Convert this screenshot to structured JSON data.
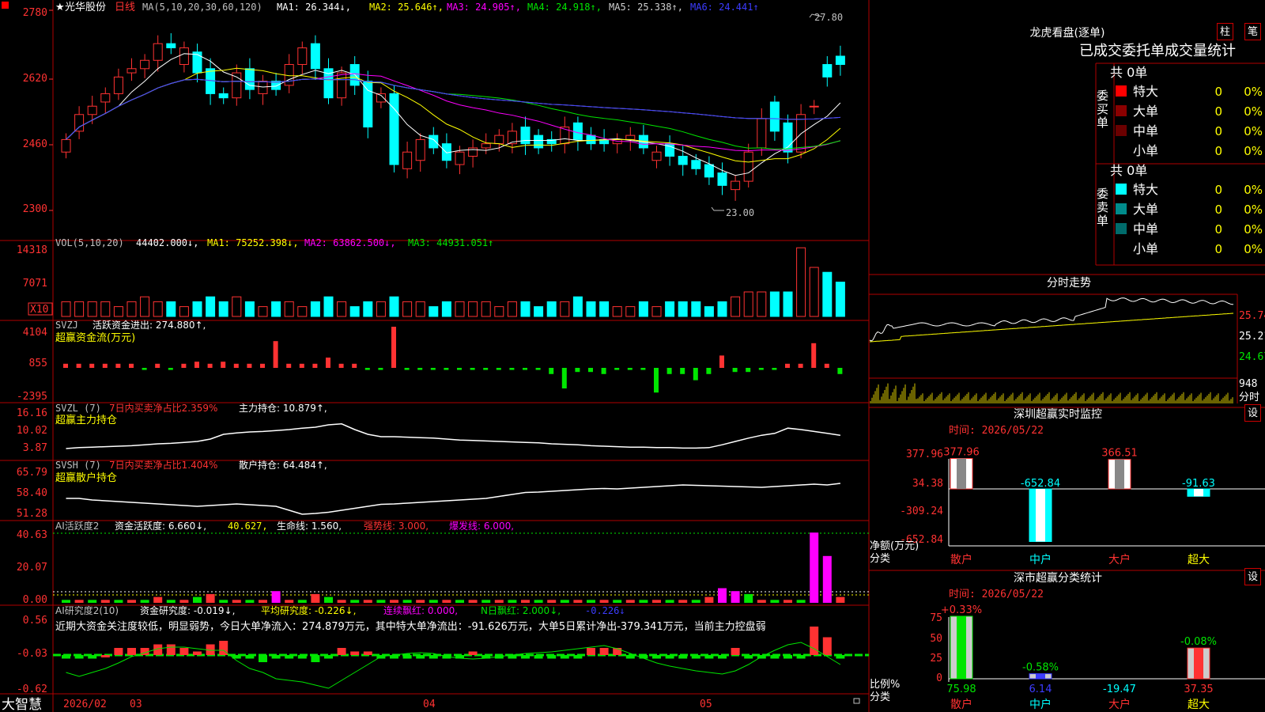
{
  "stock": {
    "name": "光华股份",
    "period": "日线",
    "star": "★"
  },
  "colors": {
    "up": "#ff3232",
    "down": "#00ffff",
    "frame": "#b00000",
    "yellow": "#ffff00",
    "magenta": "#ff00ff",
    "green": "#00e600",
    "white": "#ffffff",
    "gray": "#cfcfcf",
    "blue": "#3c3cff"
  },
  "price_panel": {
    "ma_label": "MA(5,10,20,30,60,120)",
    "ma1": "MA1: 26.344↓,",
    "ma2": "MA2: 25.646↑,",
    "ma3": "MA3: 24.905↑,",
    "ma4": "MA4: 24.918↑,",
    "ma5": "MA5: 25.338↑,",
    "ma6": "MA6: 24.441↑",
    "y_ticks": [
      "2780",
      "2620",
      "2460",
      "2300"
    ],
    "high_label": "27.80",
    "low_label": "23.00"
  },
  "vol_panel": {
    "title": "VOL(5,10,20)",
    "value": "44402.000↓,",
    "ma1": "MA1: 75252.398↓,",
    "ma2": "MA2: 63862.500↓,",
    "ma3": "MA3: 44931.051↑",
    "y_ticks": [
      "14318",
      "7071"
    ],
    "unit": "X10"
  },
  "svzj_panel": {
    "title": "SVZJ",
    "text": "活跃资金进出: 274.880↑,",
    "sub": "超赢资金流(万元)",
    "y_ticks": [
      "4104",
      "855",
      "-2395"
    ]
  },
  "svzl_panel": {
    "title": "SVZL (7)",
    "red_text": "7日内买卖净占比2.359%",
    "text": "主力持仓: 10.879↑,",
    "sub": "超赢主力持仓",
    "y_ticks": [
      "16.16",
      "10.02",
      "3.87"
    ]
  },
  "svsh_panel": {
    "title": "SVSH (7)",
    "red_text": "7日内买卖净占比1.404%",
    "text": "散户持仓: 64.484↑,",
    "sub": "超赢散户持仓",
    "y_ticks": [
      "65.79",
      "58.40",
      "51.28"
    ]
  },
  "ai_active_panel": {
    "title": "AI活跃度2",
    "text1": "资金活跃度: 6.660↓,",
    "text2": "40.627,",
    "text3": "生命线: 1.560,",
    "text4": "强势线: 3.000,",
    "text5": "爆发线: 6.000,",
    "y_ticks": [
      "40.63",
      "20.07",
      "0.00"
    ]
  },
  "ai_research_panel": {
    "title": "AI研究度2(10)",
    "text1": "资金研究度: -0.019↓,",
    "text2": "平均研究度: -0.226↓,",
    "text3": "连续飘红: 0.000,",
    "text4": "N日飘红: 2.000↓,",
    "text5": "-0.226↓",
    "comment": "近期大资金关注度较低，明显弱势，今日大单净流入：274.879万元，其中特大单净流出：-91.626万元，大单5日累计净出-379.341万元，当前主力控盘弱",
    "y_ticks": [
      "0.56",
      "-0.03",
      "-0.62"
    ]
  },
  "footer": {
    "logo": "大智慧",
    "dates": [
      "2026/02",
      "03",
      "04",
      "05"
    ]
  },
  "longhu": {
    "title": "龙虎看盘(逐单)",
    "btn1": "柱",
    "btn2": "笔",
    "header": "已成交委托单成交量统计",
    "buy_label": "委买单",
    "sell_label": "委卖单",
    "buy_total": "共 0单",
    "sell_total": "共 0单",
    "buy_rows": [
      {
        "label": "特大",
        "value": "0",
        "pct": "0%"
      },
      {
        "label": "大单",
        "value": "0",
        "pct": "0%"
      },
      {
        "label": "中单",
        "value": "0",
        "pct": "0%"
      },
      {
        "label": "小单",
        "value": "0",
        "pct": "0%"
      }
    ],
    "sell_rows": [
      {
        "label": "特大",
        "value": "0",
        "pct": "0%"
      },
      {
        "label": "大单",
        "value": "0",
        "pct": "0%"
      },
      {
        "label": "中单",
        "value": "0",
        "pct": "0%"
      },
      {
        "label": "小单",
        "value": "0",
        "pct": "0%"
      }
    ]
  },
  "intraday": {
    "title": "分时走势",
    "y_ticks": [
      "25.74",
      "25.21",
      "24.67"
    ],
    "vol_tick": "948",
    "unit": "分时"
  },
  "sz_monitor": {
    "title": "深圳超赢实时监控",
    "btn": "设",
    "time": "时间: 2026/05/22",
    "y_ticks": [
      "377.96",
      "34.38",
      "-309.24",
      "-652.84"
    ],
    "y_label": "净额(万元)",
    "x_label": "分类",
    "categories": [
      "散户",
      "中户",
      "大户",
      "超大"
    ],
    "values": [
      377.96,
      -652.84,
      366.51,
      -91.63
    ],
    "value_labels": [
      "377.96",
      "-652.84",
      "366.51",
      "-91.63"
    ]
  },
  "sz_classify": {
    "title": "深市超赢分类统计",
    "btn": "设",
    "time": "时间: 2026/05/22",
    "y_ticks": [
      "75",
      "50",
      "25",
      "0"
    ],
    "y_label": "比例%",
    "x_label": "分类",
    "categories": [
      "散户",
      "中户",
      "大户",
      "超大"
    ],
    "values": [
      75.98,
      6.14,
      -19.47,
      37.35
    ],
    "value_labels": [
      "75.98",
      "6.14",
      "-19.47",
      "37.35"
    ],
    "pct_labels": [
      "+0.33%",
      "-0.58%",
      "",
      "-0.08%"
    ]
  }
}
